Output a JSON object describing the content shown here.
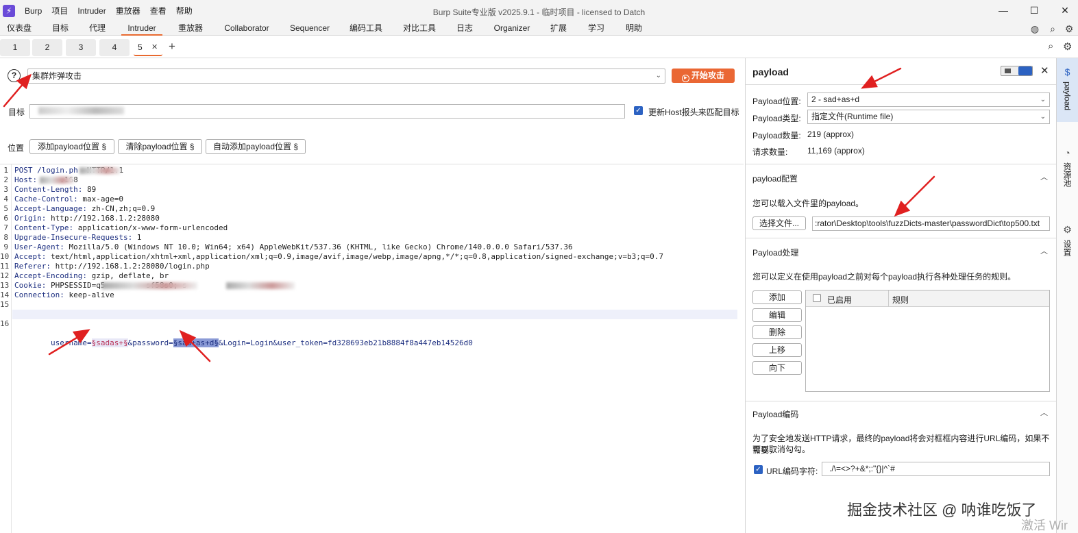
{
  "titlebar": {
    "menu": [
      "Burp",
      "项目",
      "Intruder",
      "重放器",
      "查看",
      "帮助"
    ],
    "title": "Burp Suite专业版  v2025.9.1 - 临时项目 - licensed to Datch"
  },
  "main_tabs": [
    {
      "label": "仪表盘",
      "active": false
    },
    {
      "label": "目标",
      "active": false
    },
    {
      "label": "代理",
      "active": false
    },
    {
      "label": "Intruder",
      "active": true
    },
    {
      "label": "重放器",
      "active": false
    },
    {
      "label": "Collaborator",
      "active": false
    },
    {
      "label": "Sequencer",
      "active": false
    },
    {
      "label": "编码工具",
      "active": false
    },
    {
      "label": "对比工具",
      "active": false
    },
    {
      "label": "日志",
      "active": false
    },
    {
      "label": "Organizer",
      "active": false
    },
    {
      "label": "扩展",
      "active": false
    },
    {
      "label": "学习",
      "active": false
    },
    {
      "label": "明助",
      "active": false
    }
  ],
  "sub_tabs": [
    "1",
    "2",
    "3",
    "4",
    "5"
  ],
  "attack": {
    "type": "集群炸弹攻击",
    "start_label": "开始攻击"
  },
  "target": {
    "label": "目标",
    "update_host_label": "更新Host报头来匹配目标",
    "update_host_checked": true
  },
  "positions": {
    "label": "位置",
    "add_label": "添加payload位置 §",
    "clear_label": "清除payload位置 §",
    "auto_label": "自动添加payload位置 §"
  },
  "request_lines": [
    {
      "n": "1",
      "key": "POST /login.ph",
      "val": "  HTTP/1.1"
    },
    {
      "n": "2",
      "key": "Host:",
      "val": "     .168"
    },
    {
      "n": "3",
      "key": "Content-Length:",
      "val": " 89"
    },
    {
      "n": "4",
      "key": "Cache-Control:",
      "val": " max-age=0"
    },
    {
      "n": "5",
      "key": "Accept-Language:",
      "val": " zh-CN,zh;q=0.9"
    },
    {
      "n": "6",
      "key": "Origin:",
      "val": " http://192.168.1.2:28080"
    },
    {
      "n": "7",
      "key": "Content-Type:",
      "val": " application/x-www-form-urlencoded"
    },
    {
      "n": "8",
      "key": "Upgrade-Insecure-Requests:",
      "val": " 1"
    },
    {
      "n": "9",
      "key": "User-Agent:",
      "val": " Mozilla/5.0 (Windows NT 10.0; Win64; x64) AppleWebKit/537.36 (KHTML, like Gecko) Chrome/140.0.0.0 Safari/537.36"
    },
    {
      "n": "10",
      "key": "Accept:",
      "val": " text/html,application/xhtml+xml,application/xml;q=0.9,image/avif,image/webp,image/apng,*/*;q=0.8,application/signed-exchange;v=b3;q=0.7"
    },
    {
      "n": "11",
      "key": "Referer:",
      "val": " http://192.168.1.2:28080/login.php"
    },
    {
      "n": "12",
      "key": "Accept-Encoding:",
      "val": " gzip, deflate, br"
    },
    {
      "n": "13",
      "key": "Cookie:",
      "val": " PHPSESSID=q5         sf58s0; s"
    },
    {
      "n": "14",
      "key": "Connection:",
      "val": " keep-alive"
    },
    {
      "n": "15",
      "key": "",
      "val": ""
    }
  ],
  "body_line": {
    "n": "16",
    "p1": "username=",
    "m1": "§sadas+§",
    "p2": "&password=",
    "m2": "§sad+as+d§",
    "p3": "&Login=Login&user_token=fd328693eb21b8884f8a447eb14526d0"
  },
  "payload_panel": {
    "title": "payload",
    "position_label": "Payload位置:",
    "position_value": "2 - sad+as+d",
    "type_label": "Payload类型:",
    "type_value": "指定文件(Runtime file)",
    "count_label": "Payload数量:",
    "count_value": "219 (approx)",
    "requests_label": "请求数量:",
    "requests_value": "11,169 (approx)",
    "config_title": "payload配置",
    "config_desc": "您可以载入文件里的payload。",
    "choose_file_label": "选择文件...",
    "file_path": ":rator\\Desktop\\tools\\fuzzDicts-master\\passwordDict\\top500.txt",
    "processing_title": "Payload处理",
    "processing_desc": "您可以定义在使用payload之前对每个payload执行各种处理任务的规则。",
    "rule_buttons": [
      "添加",
      "编辑",
      "删除",
      "上移",
      "向下"
    ],
    "col_enabled": "已启用",
    "col_rule": "规则",
    "encoding_title": "Payload编码",
    "encoding_desc_1": "为了安全地发送HTTP请求，最终的payload将会对框框内容进行URL编码，如果不需要，",
    "encoding_desc_2": "可以取消勾勾。",
    "url_encode_label": "URL编码字符:",
    "url_encode_chars": "./\\=<>?+&*;:\"{}|^`#",
    "url_encode_checked": true
  },
  "sidebar": {
    "tabs": [
      {
        "label": "payload",
        "active": true
      },
      {
        "label": "资源池",
        "active": false
      },
      {
        "label": "设置",
        "active": false
      }
    ]
  },
  "watermark": "掘金技术社区 @ 呐谁吃饭了",
  "activate_text": "激活 Wir",
  "colors": {
    "accent": "#e8692f",
    "start_button": "#ea6734",
    "checkbox": "#2c62c2",
    "arrow": "#e02020"
  }
}
